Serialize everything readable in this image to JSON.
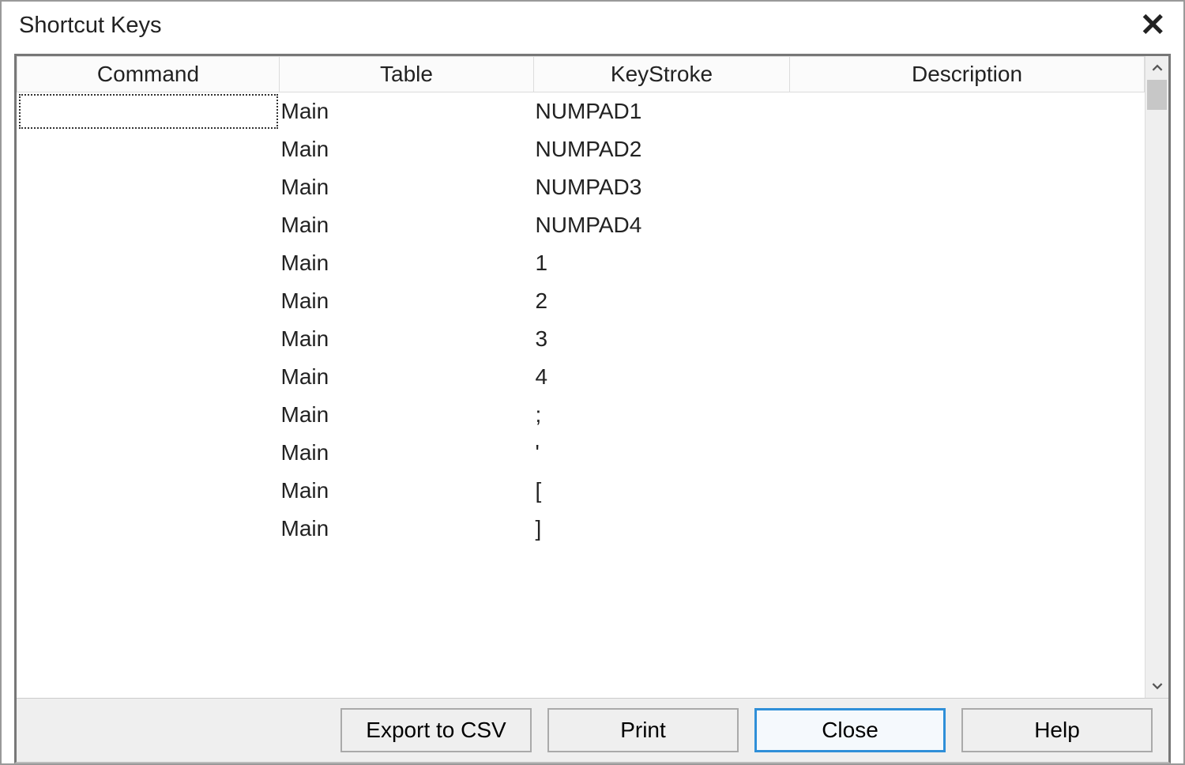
{
  "title": "Shortcut Keys",
  "columns": {
    "command": "Command",
    "table": "Table",
    "keystroke": "KeyStroke",
    "description": "Description"
  },
  "rows": [
    {
      "command": "",
      "table": "Main",
      "keystroke": "NUMPAD1",
      "description": ""
    },
    {
      "command": "",
      "table": "Main",
      "keystroke": "NUMPAD2",
      "description": ""
    },
    {
      "command": "",
      "table": "Main",
      "keystroke": "NUMPAD3",
      "description": ""
    },
    {
      "command": "",
      "table": "Main",
      "keystroke": "NUMPAD4",
      "description": ""
    },
    {
      "command": "",
      "table": "Main",
      "keystroke": "1",
      "description": ""
    },
    {
      "command": "",
      "table": "Main",
      "keystroke": "2",
      "description": ""
    },
    {
      "command": "",
      "table": "Main",
      "keystroke": "3",
      "description": ""
    },
    {
      "command": "",
      "table": "Main",
      "keystroke": "4",
      "description": ""
    },
    {
      "command": "",
      "table": "Main",
      "keystroke": ";",
      "description": ""
    },
    {
      "command": "",
      "table": "Main",
      "keystroke": "'",
      "description": ""
    },
    {
      "command": "",
      "table": "Main",
      "keystroke": "[",
      "description": ""
    },
    {
      "command": "",
      "table": "Main",
      "keystroke": "]",
      "description": ""
    }
  ],
  "buttons": {
    "export": "Export to CSV",
    "print": "Print",
    "close": "Close",
    "help": "Help"
  }
}
